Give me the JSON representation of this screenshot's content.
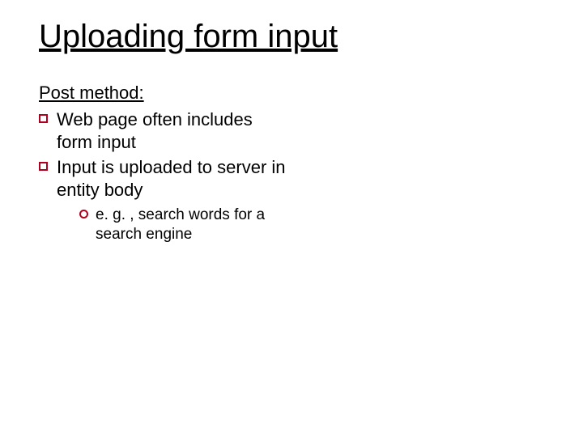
{
  "title": "Uploading form input",
  "subhead": "Post method:",
  "bullets": [
    {
      "text": "Web page often includes form input"
    },
    {
      "text": "Input is uploaded to server in entity body",
      "sub": [
        {
          "text": "e. g. , search words for a search engine"
        }
      ]
    }
  ]
}
